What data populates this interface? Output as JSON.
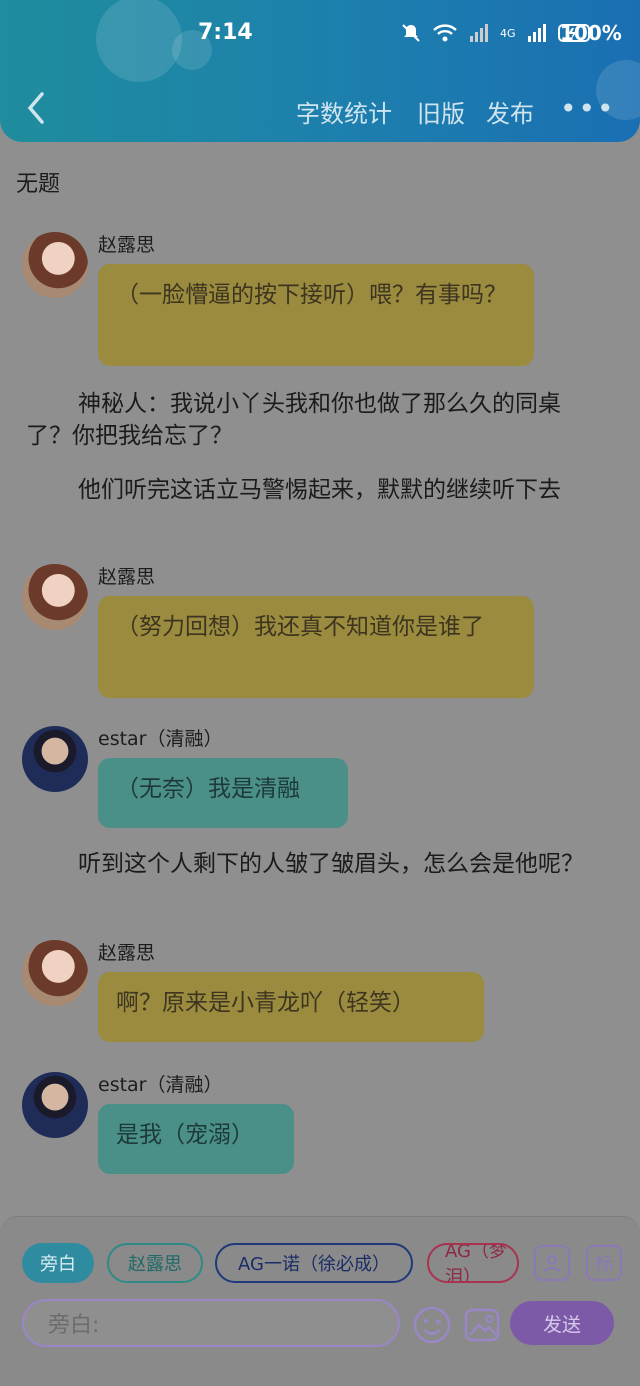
{
  "status": {
    "time": "7:14",
    "battery": "100%",
    "network": "4G"
  },
  "nav": {
    "word_count": "字数统计",
    "old_version": "旧版",
    "publish": "发布",
    "more": "•••"
  },
  "doc_title": "无题",
  "messages": [
    {
      "type": "dialog",
      "speaker": "赵露思",
      "text": "（一脸懵逼的按下接听）喂？有事吗？",
      "color": "yellow",
      "avatar": "girl-avatar"
    },
    {
      "type": "narration",
      "text": "神秘人：我说小丫头我和你也做了那么久的同桌了？你把我给忘了？"
    },
    {
      "type": "narration",
      "text": "他们听完这话立马警惕起来，默默的继续听下去"
    },
    {
      "type": "dialog",
      "speaker": "赵露思",
      "text": "（努力回想）我还真不知道你是谁了",
      "color": "yellow",
      "avatar": "girl-avatar"
    },
    {
      "type": "dialog",
      "speaker": "estar（清融）",
      "text": "（无奈）我是清融",
      "color": "teal",
      "avatar": "boy-avatar"
    },
    {
      "type": "narration",
      "text": "听到这个人剩下的人皱了皱眉头，怎么会是他呢？"
    },
    {
      "type": "dialog",
      "speaker": "赵露思",
      "text": "啊？原来是小青龙吖（轻笑）",
      "color": "yellow",
      "avatar": "girl-avatar"
    },
    {
      "type": "dialog",
      "speaker": "estar（清融）",
      "text": "是我（宠溺）",
      "color": "teal",
      "avatar": "boy-avatar"
    }
  ],
  "roles": [
    {
      "label": "旁白",
      "style": "active"
    },
    {
      "label": "赵露思",
      "style": "outline-teal"
    },
    {
      "label": "AG一诺（徐必成）",
      "style": "outline-blue"
    },
    {
      "label": "AG（梦泪）",
      "style": "outline-red"
    }
  ],
  "tools": {
    "role_icon": "user-icon",
    "tag_label": "标"
  },
  "composer": {
    "placeholder": "旁白:",
    "send_label": "发送"
  },
  "colors": {
    "header_start": "#1f8d9d",
    "header_end": "#1a6fb2",
    "bubble_yellow": "#9b8b3f",
    "bubble_teal": "#4a8f88",
    "send": "#7d5aa8"
  }
}
